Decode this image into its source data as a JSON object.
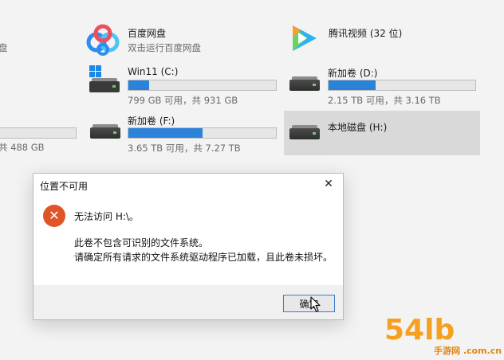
{
  "drives_left_partial": {
    "top_sub": "盘",
    "bottom_sub": "共 488 GB"
  },
  "apps": [
    {
      "name": "百度网盘",
      "desc": "双击运行百度网盘",
      "icon": "baidu-netdisk-icon"
    },
    {
      "name": "腾讯视频 (32 位)",
      "icon": "tencent-video-icon"
    }
  ],
  "drives": [
    {
      "name": "Win11 (C:)",
      "space": "799 GB 可用，共 931 GB",
      "used_fraction": 0.14,
      "icon": "windows-drive-icon"
    },
    {
      "name": "新加卷 (D:)",
      "space": "2.15 TB 可用，共 3.16 TB",
      "used_fraction": 0.32,
      "icon": "hard-drive-icon"
    },
    {
      "name": "新加卷 (F:)",
      "space": "3.65 TB 可用，共 7.27 TB",
      "used_fraction": 0.5,
      "icon": "hard-drive-icon"
    },
    {
      "name": "本地磁盘 (H:)",
      "icon": "hard-drive-icon",
      "selected": true
    }
  ],
  "dialog": {
    "title": "位置不可用",
    "close_symbol": "✕",
    "icon": "error-icon",
    "icon_glyph": "✕",
    "message": "无法访问 H:\\。",
    "detail_lines": [
      "此卷不包含可识别的文件系统。",
      "请确定所有请求的文件系统驱动程序已加载，且此卷未损坏。"
    ],
    "ok_label": "确定"
  },
  "watermark": {
    "main": "54lb",
    "sub": "手游网 .com.cn"
  },
  "colors": {
    "accent": "#2b82d9",
    "selection": "#d9d9d9",
    "error": "#e0542a",
    "watermark": "#f5a020"
  }
}
